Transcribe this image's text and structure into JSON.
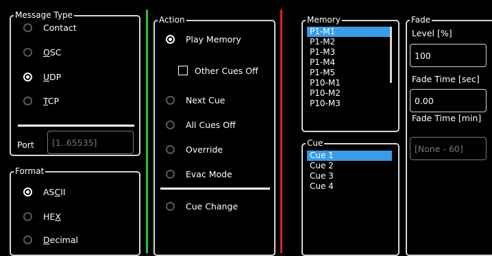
{
  "message_type": {
    "title": "Message Type",
    "options": [
      {
        "label": "Contact",
        "checked": false
      },
      {
        "label": "OSC",
        "checked": false
      },
      {
        "label": "UDP",
        "checked": true
      },
      {
        "label": "TCP",
        "checked": false
      }
    ],
    "port_label": "Port",
    "port_placeholder": "[1..65535]"
  },
  "format": {
    "title": "Format",
    "options": [
      {
        "label": "ASCII",
        "checked": true
      },
      {
        "label": "HEX",
        "checked": false
      },
      {
        "label": "Decimal",
        "checked": false
      }
    ]
  },
  "action": {
    "title": "Action",
    "options": [
      {
        "label": "Play Memory",
        "checked": true
      },
      {
        "label": "Next Cue",
        "checked": false
      },
      {
        "label": "All Cues Off",
        "checked": false
      },
      {
        "label": "Override",
        "checked": false
      },
      {
        "label": "Evac Mode",
        "checked": false
      },
      {
        "label": "Cue Change",
        "checked": false
      }
    ],
    "other_cues_off_label": "Other Cues Off",
    "other_cues_off_checked": false
  },
  "memory": {
    "title": "Memory",
    "items": [
      "P1-M1",
      "P1-M2",
      "P1-M3",
      "P1-M4",
      "P1-M5",
      "P10-M1",
      "P10-M2",
      "P10-M3"
    ],
    "selected_index": 0
  },
  "cue": {
    "title": "Cue",
    "items": [
      "Cue 1",
      "Cue 2",
      "Cue 3",
      "Cue 4"
    ],
    "selected_index": 0
  },
  "fade": {
    "title": "Fade",
    "level_label": "Level [%]",
    "level_value": "100",
    "fade_time_sec_label": "Fade Time [sec]",
    "fade_time_sec_value": "0.00",
    "fade_time_min_label": "Fade Time [min]",
    "fade_time_min_placeholder": "[None - 60]"
  },
  "colors": {
    "divider_green": "#2fc42f",
    "divider_red": "#e02222",
    "selection": "#3a9be6"
  }
}
